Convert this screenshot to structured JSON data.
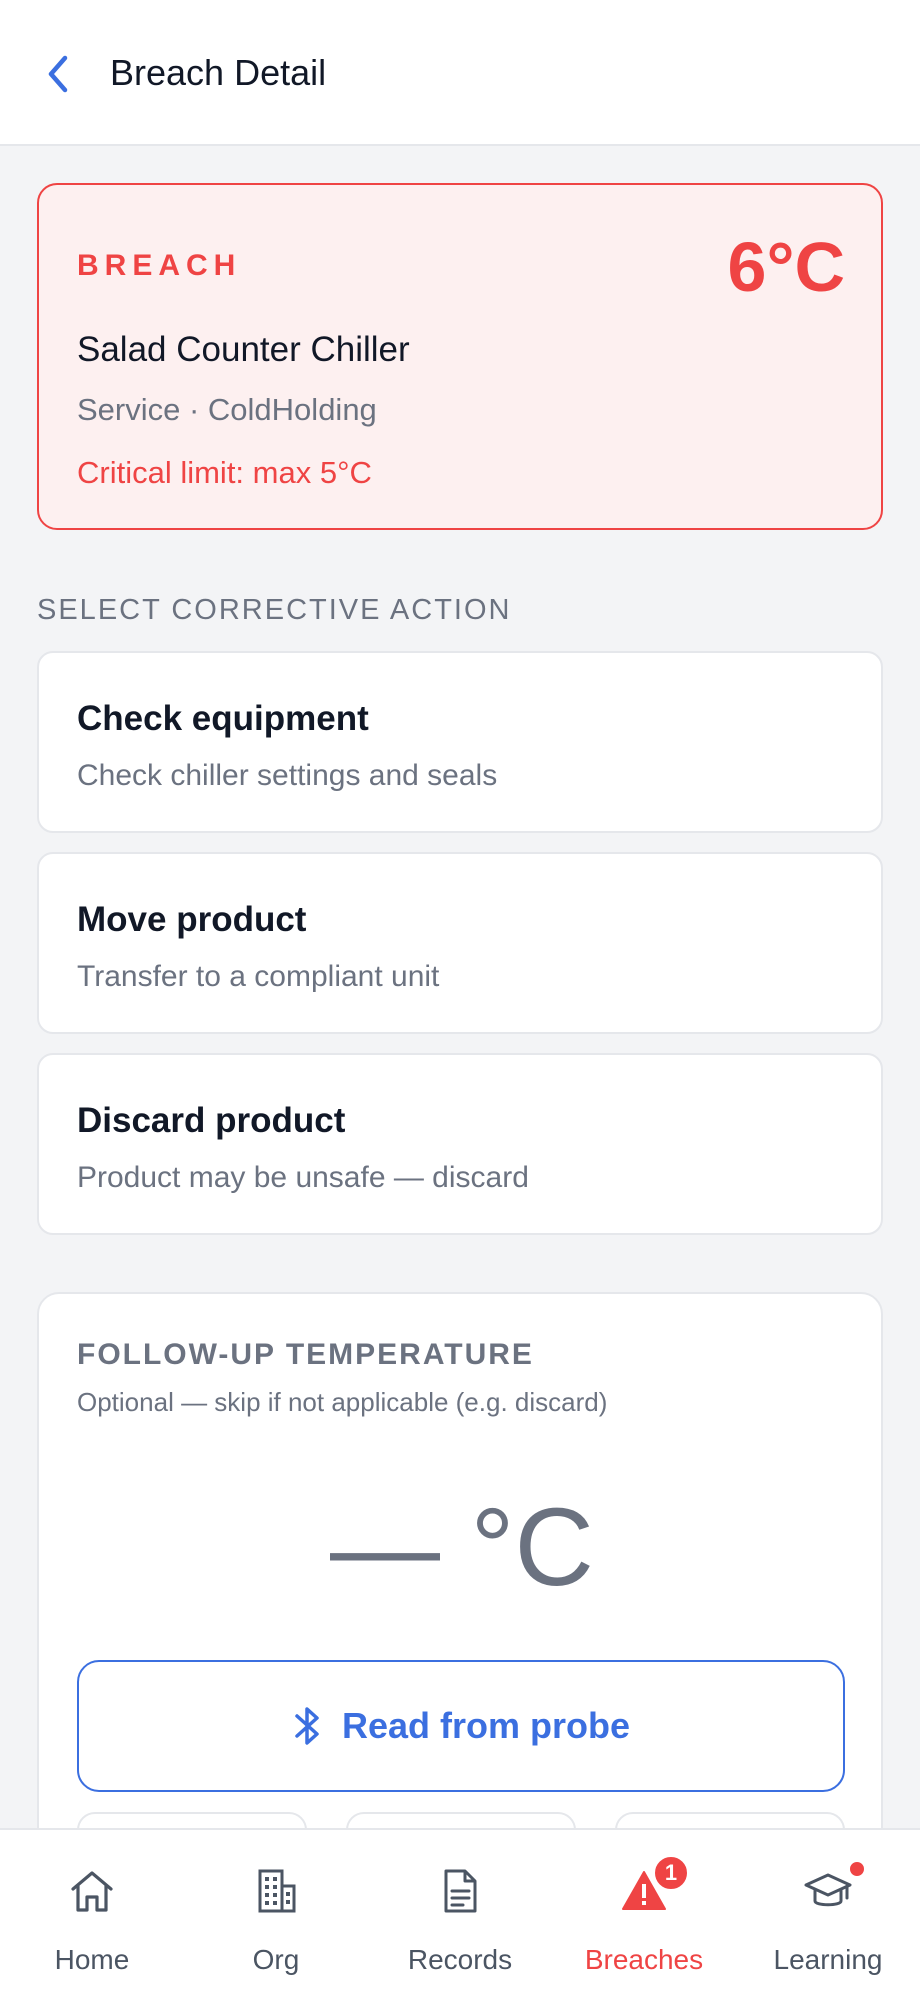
{
  "header": {
    "title": "Breach Detail"
  },
  "breach": {
    "tag": "BREACH",
    "temperature": "6°C",
    "unit_name": "Salad Counter Chiller",
    "unit_meta": "Service · ColdHolding",
    "critical_limit": "Critical limit: max 5°C",
    "accent_color": "#ef4444"
  },
  "corrective": {
    "section_label": "SELECT CORRECTIVE ACTION",
    "actions": [
      {
        "title": "Check equipment",
        "description": "Check chiller settings and seals"
      },
      {
        "title": "Move product",
        "description": "Transfer to a compliant unit"
      },
      {
        "title": "Discard product",
        "description": "Product may be unsafe — discard"
      }
    ]
  },
  "followup": {
    "title": "FOLLOW-UP TEMPERATURE",
    "subtitle": "Optional — skip if not applicable (e.g. discard)",
    "temperature_display": "— °C",
    "probe_button": {
      "label": "Read from probe",
      "icon": "bluetooth-icon"
    },
    "primary_color": "#3b6fe0"
  },
  "nav": {
    "items": [
      {
        "label": "Home",
        "icon": "home-icon"
      },
      {
        "label": "Org",
        "icon": "building-icon"
      },
      {
        "label": "Records",
        "icon": "document-icon"
      },
      {
        "label": "Breaches",
        "icon": "warning-icon",
        "badge": "1",
        "active": true
      },
      {
        "label": "Learning",
        "icon": "graduation-cap-icon"
      }
    ]
  }
}
